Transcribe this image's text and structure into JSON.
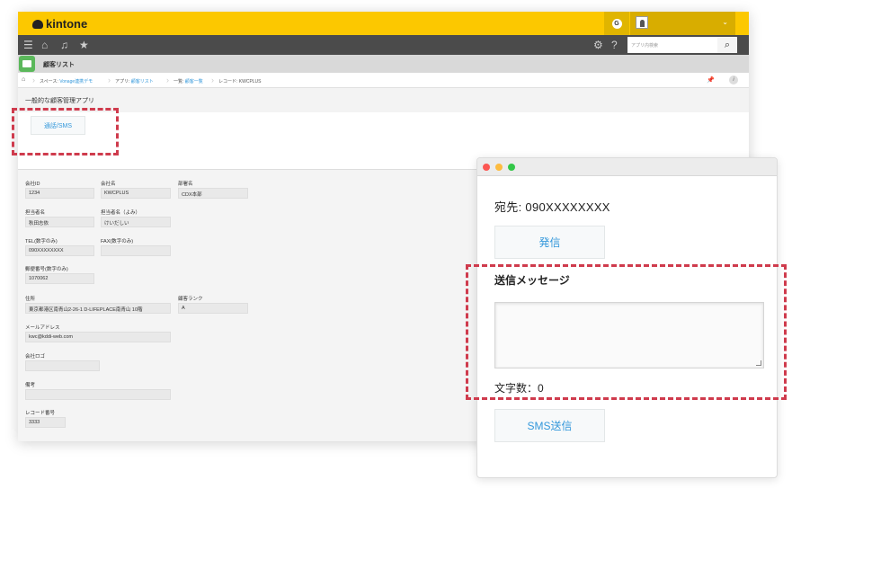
{
  "header": {
    "logo_text": "kintone",
    "g_badge": "G",
    "search_placeholder": "アプリ内検索"
  },
  "app": {
    "title": "顧客リスト"
  },
  "breadcrumb": {
    "space_prefix": "スペース:",
    "space_value": "Vonage連携デモ",
    "app_prefix": "アプリ:",
    "app_value": "顧客リスト",
    "list_prefix": "一覧:",
    "list_value": "顧客一覧",
    "record_label": "レコード: KWCPLUS"
  },
  "page": {
    "subtitle": "一般的な顧客管理アプリ"
  },
  "toolbar": {
    "call_button_label": "通話/SMS"
  },
  "form": {
    "fields": [
      {
        "label": "会社ID",
        "value": "1234"
      },
      {
        "label": "会社名",
        "value": "KWCPLUS"
      },
      {
        "label": "部署名",
        "value": "CDX本部"
      },
      {
        "label": "担当者名",
        "value": "秋田志依"
      },
      {
        "label": "担当者名（よみ）",
        "value": "けいだしい"
      },
      {
        "label": "TEL(数字のみ)",
        "value": "090XXXXXXXX"
      },
      {
        "label": "FAX(数字のみ)",
        "value": ""
      },
      {
        "label": "郵便番号(数字のみ)",
        "value": "1070062"
      },
      {
        "label": "住所",
        "value": "東京都港区南青山2-26-1 D-LIFEPLACE南青山 10階"
      },
      {
        "label": "顧客ランク",
        "value": "A"
      },
      {
        "label": "メールアドレス",
        "value": "kwc@kddi-web.com"
      },
      {
        "label": "会社ロゴ",
        "value": ""
      },
      {
        "label": "備考",
        "value": ""
      },
      {
        "label": "レコード番号",
        "value": "3333"
      }
    ]
  },
  "popup": {
    "destination": "宛先: 090XXXXXXXX",
    "call_button": "発信",
    "message_label": "送信メッセージ",
    "char_count": "文字数：0",
    "sms_button": "SMS送信"
  },
  "colors": {
    "header_yellow": "#fcc800",
    "nav_dark": "#4b4b4b",
    "link_blue": "#3498db",
    "highlight_red": "#cf3b4d"
  }
}
